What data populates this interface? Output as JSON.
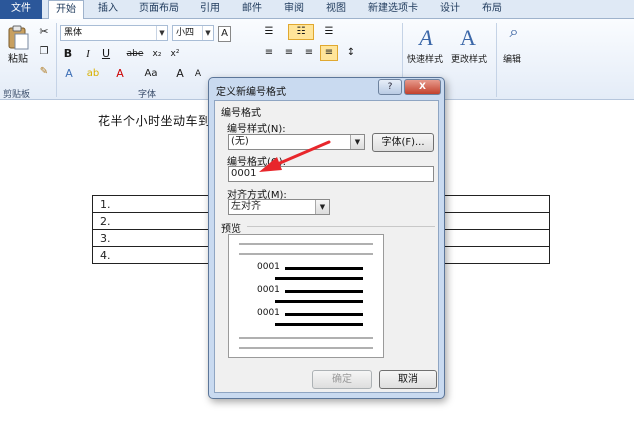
{
  "tabs": [
    {
      "label": "文件"
    },
    {
      "label": "开始"
    },
    {
      "label": "插入"
    },
    {
      "label": "页面布局"
    },
    {
      "label": "引用"
    },
    {
      "label": "邮件"
    },
    {
      "label": "审阅"
    },
    {
      "label": "视图"
    },
    {
      "label": "新建选项卡"
    },
    {
      "label": "设计"
    },
    {
      "label": "布局"
    }
  ],
  "ribbon": {
    "paste_label": "粘贴",
    "clipboard_group": "剪贴板",
    "font_group": "字体",
    "font_name": "黑体",
    "font_size": "小四",
    "bold": "B",
    "italic": "I",
    "underline": "U",
    "strike": "abe",
    "subscript": "x₂",
    "superscript": "x²",
    "aa_label": "Aa",
    "a_upper": "A",
    "quick_style_label": "快速样式",
    "change_style_label": "更改样式",
    "edit_label": "编辑"
  },
  "document": {
    "line": "花半个小时坐动车到",
    "rows": [
      "1.",
      "2.",
      "3.",
      "4."
    ]
  },
  "dialog": {
    "title": "定义新编号格式",
    "help": "?",
    "close": "X",
    "section_label": "编号格式",
    "style_label": "编号样式(N):",
    "style_value": "(无)",
    "font_button": "字体(F)...",
    "format_label": "编号格式(O):",
    "format_value": "0001",
    "align_label": "对齐方式(M):",
    "align_value": "左对齐",
    "preview_label": "预览",
    "preview_numbers": [
      "0001",
      "0001",
      "0001"
    ],
    "ok": "确定",
    "cancel": "取消"
  },
  "colors": {
    "accent": "#2b579a",
    "arrow": "#e8262b",
    "dialog_frame": "#c9daf0"
  }
}
